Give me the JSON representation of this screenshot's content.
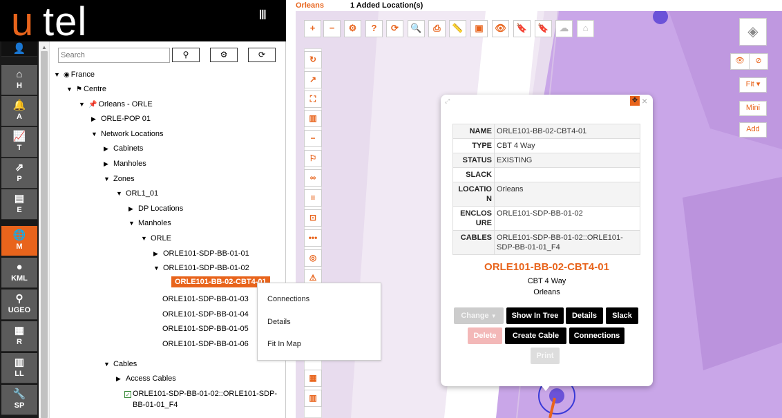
{
  "brand": {
    "logo_u": "u",
    "logo_rest": "tel",
    "menu_icon": "|||"
  },
  "nav": {
    "items": [
      {
        "name": "user-icon",
        "glyph": "👤",
        "label": ""
      },
      {
        "name": "home-icon",
        "glyph": "⌂",
        "label": "H"
      },
      {
        "name": "bell-icon",
        "glyph": "🔔",
        "label": "A"
      },
      {
        "name": "chart-icon",
        "glyph": "📈",
        "label": "T"
      },
      {
        "name": "share-icon",
        "glyph": "⇗",
        "label": "P"
      },
      {
        "name": "chip-icon",
        "glyph": "▤",
        "label": "E"
      },
      {
        "name": "globe-icon",
        "glyph": "🌐",
        "label": "M"
      },
      {
        "name": "pin-icon",
        "glyph": "●",
        "label": "KML"
      },
      {
        "name": "pushpin-icon",
        "glyph": "⚲",
        "label": "UGEO"
      },
      {
        "name": "server-icon",
        "glyph": "▦",
        "label": "R"
      },
      {
        "name": "book-icon",
        "glyph": "▥",
        "label": "LL"
      },
      {
        "name": "wrench-icon",
        "glyph": "🔧",
        "label": "SP"
      }
    ]
  },
  "search": {
    "placeholder": "Search"
  },
  "tree": {
    "rows": [
      {
        "name": "tree-france",
        "toggle": "▼",
        "icon": "◉",
        "label": "France"
      },
      {
        "name": "tree-centre",
        "toggle": "▼",
        "icon": "⚑",
        "label": "Centre"
      },
      {
        "name": "tree-orleans",
        "toggle": "▼",
        "icon": "📌",
        "label": "Orleans - ORLE"
      },
      {
        "name": "tree-orle-pop-01",
        "toggle": "▶",
        "icon": "",
        "label": "ORLE-POP 01"
      },
      {
        "name": "tree-network-locations",
        "toggle": "▼",
        "icon": "",
        "label": "Network Locations"
      },
      {
        "name": "tree-cabinets",
        "toggle": "▶",
        "icon": "",
        "label": "Cabinets"
      },
      {
        "name": "tree-manholes",
        "toggle": "▶",
        "icon": "",
        "label": "Manholes"
      },
      {
        "name": "tree-zones",
        "toggle": "▼",
        "icon": "",
        "label": "Zones"
      },
      {
        "name": "tree-orl1-01",
        "toggle": "▼",
        "icon": "",
        "label": "ORL1_01"
      },
      {
        "name": "tree-dp-locations",
        "toggle": "▶",
        "icon": "",
        "label": "DP Locations"
      },
      {
        "name": "tree-zone-manholes",
        "toggle": "▼",
        "icon": "",
        "label": "Manholes"
      },
      {
        "name": "tree-orle",
        "toggle": "▼",
        "icon": "",
        "label": "ORLE"
      },
      {
        "name": "tree-sdp-bb-01-01",
        "toggle": "▶",
        "icon": "",
        "label": "ORLE101-SDP-BB-01-01"
      },
      {
        "name": "tree-sdp-bb-01-02",
        "toggle": "▼",
        "icon": "",
        "label": "ORLE101-SDP-BB-01-02"
      },
      {
        "name": "tree-bb-02-cbt4-01",
        "toggle": "",
        "icon": "",
        "label": "ORLE101-BB-02-CBT4-01"
      },
      {
        "name": "tree-sdp-bb-01-03",
        "toggle": "",
        "icon": "",
        "label": "ORLE101-SDP-BB-01-03"
      },
      {
        "name": "tree-sdp-bb-01-04",
        "toggle": "",
        "icon": "",
        "label": "ORLE101-SDP-BB-01-04"
      },
      {
        "name": "tree-sdp-bb-01-05",
        "toggle": "",
        "icon": "",
        "label": "ORLE101-SDP-BB-01-05"
      },
      {
        "name": "tree-sdp-bb-01-06",
        "toggle": "",
        "icon": "",
        "label": "ORLE101-SDP-BB-01-06"
      },
      {
        "name": "tree-cables",
        "toggle": "▼",
        "icon": "",
        "label": "Cables"
      },
      {
        "name": "tree-access-cables",
        "toggle": "▶",
        "icon": "",
        "label": "Access Cables"
      }
    ],
    "cable_line1": "ORLE101-SDP-BB-01-02::ORLE101-SDP-",
    "cable_line2": "BB-01-01_F4"
  },
  "context_menu": {
    "items": [
      "Connections",
      "Details",
      "Fit In Map"
    ]
  },
  "map": {
    "location": "Orleans",
    "added": "1 Added Location(s)",
    "toolbar": [
      "+",
      "−",
      "⚙",
      "?",
      "⟳",
      "🔍",
      "⎙",
      "📏",
      "▣",
      "👁",
      "🔖",
      "🔖",
      "☁",
      "⌂"
    ],
    "side": [
      "↻",
      "↗",
      "⛶",
      "▥",
      "−",
      "⚐",
      "∞",
      "≡",
      "⊡",
      "•••",
      "◎",
      "⚠"
    ],
    "right": {
      "fit": "Fit ▾",
      "mini": "Mini",
      "add": "Add"
    }
  },
  "popup": {
    "attributes": [
      {
        "key": "NAME",
        "value": "ORLE101-BB-02-CBT4-01"
      },
      {
        "key": "TYPE",
        "value": "CBT 4 Way"
      },
      {
        "key": "STATUS",
        "value": "EXISTING"
      },
      {
        "key": "SLACK",
        "value": ""
      },
      {
        "key": "LOCATION",
        "value": "Orleans"
      },
      {
        "key": "ENCLOSURE",
        "value": "ORLE101-SDP-BB-01-02"
      },
      {
        "key": "CABLES",
        "value": "ORLE101-SDP-BB-01-02::ORLE101-SDP-BB-01-01_F4"
      }
    ],
    "title": "ORLE101-BB-02-CBT4-01",
    "subtitle": "CBT 4 Way",
    "location": "Orleans",
    "buttons": {
      "change": "Change",
      "show_in_tree": "Show In Tree",
      "details": "Details",
      "slack": "Slack",
      "delete": "Delete",
      "create_cable": "Create Cable",
      "connections": "Connections",
      "print": "Print"
    }
  },
  "colors": {
    "accent": "#e8641c",
    "map_purple": "#c9a0e8",
    "map_purple_dark": "#b98bd9"
  }
}
